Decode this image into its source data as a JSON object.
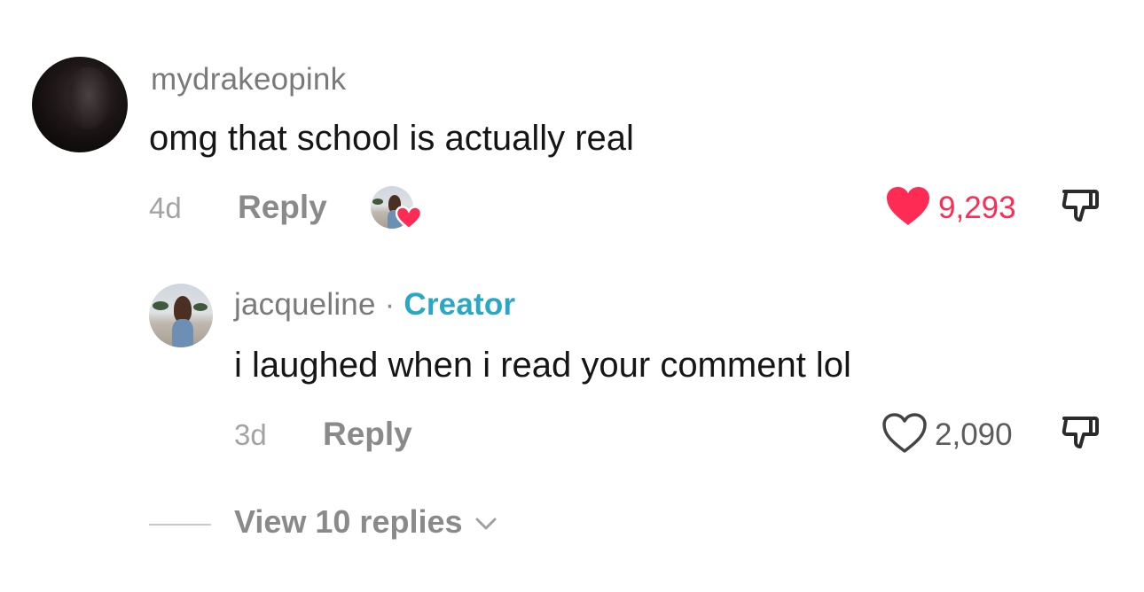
{
  "comment": {
    "username": "mydrakeopink",
    "text": "omg that school is actually real",
    "time": "4d",
    "reply_label": "Reply",
    "like_count": "9,293",
    "liked": true,
    "like_color": "#fe2c55"
  },
  "reply": {
    "username": "jacqueline",
    "separator": "·",
    "creator_label": "Creator",
    "creator_color": "#2aa7c6",
    "text": "i laughed when i read your comment lol",
    "time": "3d",
    "reply_label": "Reply",
    "like_count": "2,090",
    "liked": false
  },
  "view_replies": {
    "label": "View 10 replies"
  },
  "icons": {
    "like_filled": "heart-filled-icon",
    "like_outline": "heart-outline-icon",
    "dislike": "thumbs-down-icon",
    "expand": "chevron-down-icon",
    "creator_liked_badge": "heart-badge-icon"
  }
}
